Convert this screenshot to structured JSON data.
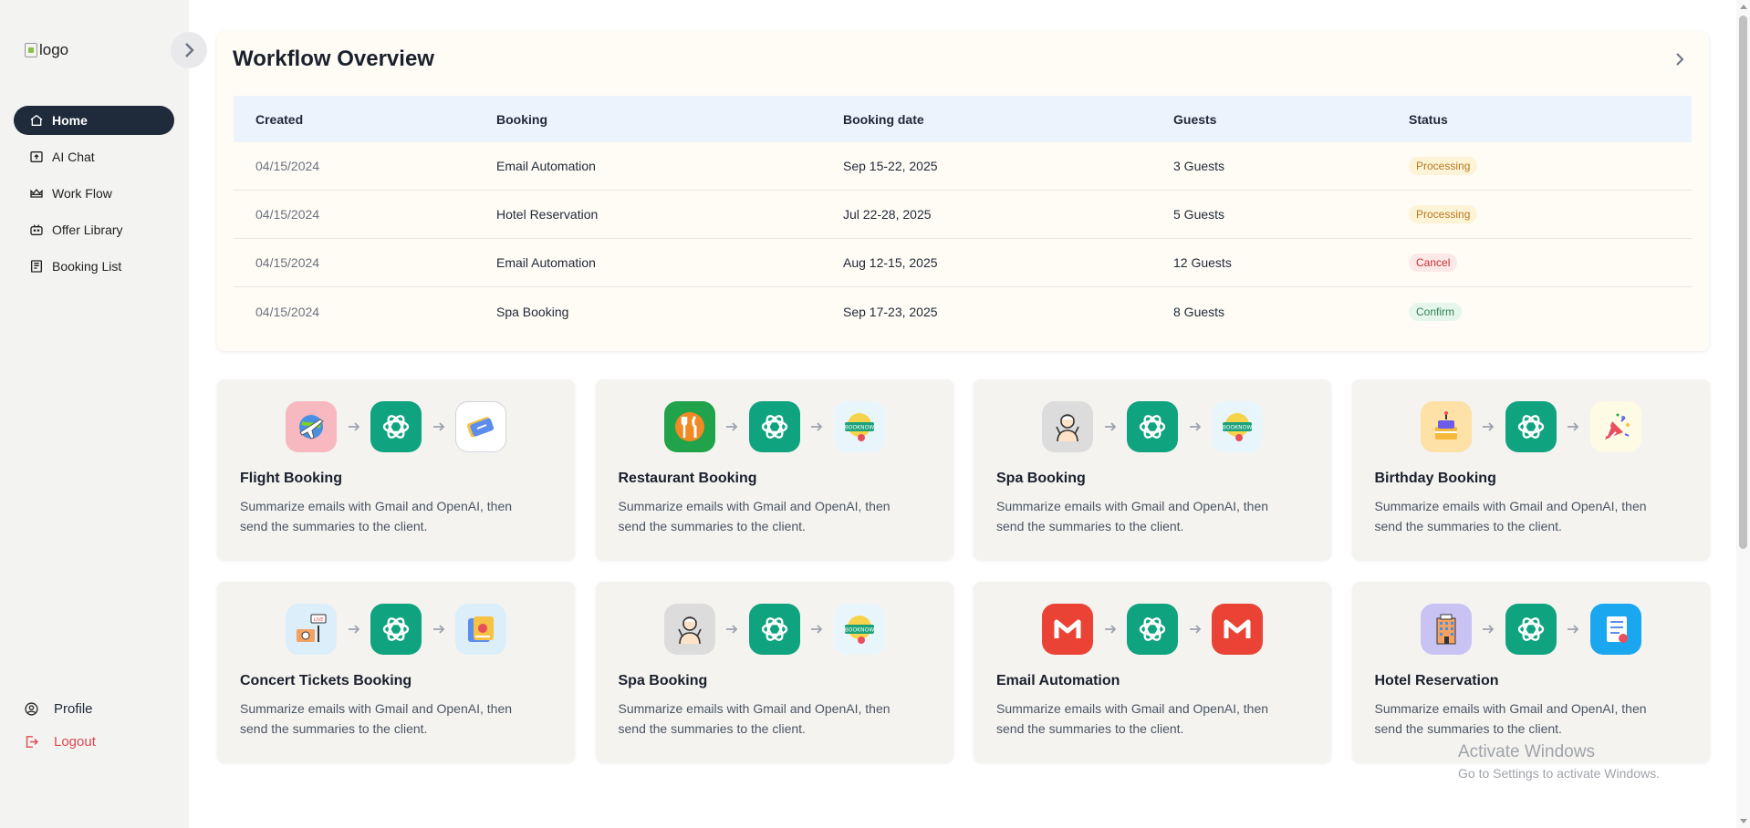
{
  "sidebar": {
    "logo_alt": "logo",
    "collapse_icon": "chevron-right-icon",
    "items": [
      {
        "label": "Home",
        "icon": "home-icon",
        "active": true
      },
      {
        "label": "AI Chat",
        "icon": "chat-upload-icon",
        "active": false
      },
      {
        "label": "Work Flow",
        "icon": "crown-icon",
        "active": false
      },
      {
        "label": "Offer Library",
        "icon": "robot-icon",
        "active": false
      },
      {
        "label": "Booking List",
        "icon": "book-icon",
        "active": false
      }
    ],
    "profile_label": "Profile",
    "logout_label": "Logout"
  },
  "overview": {
    "title": "Workflow Overview",
    "columns": [
      "Created",
      "Booking",
      "Booking date",
      "Guests",
      "Status"
    ],
    "rows": [
      {
        "created": "04/15/2024",
        "booking": "Email Automation",
        "date": "Sep 15-22, 2025",
        "guests": "3 Guests",
        "status": "Processing"
      },
      {
        "created": "04/15/2024",
        "booking": "Hotel Reservation",
        "date": "Jul 22-28, 2025",
        "guests": "5 Guests",
        "status": "Processing"
      },
      {
        "created": "04/15/2024",
        "booking": "Email Automation",
        "date": "Aug 12-15, 2025",
        "guests": "12 Guests",
        "status": "Cancel"
      },
      {
        "created": "04/15/2024",
        "booking": "Spa Booking",
        "date": "Sep 17-23, 2025",
        "guests": "8 Guests",
        "status": "Confirm"
      }
    ]
  },
  "cards": [
    {
      "title": "Flight Booking",
      "desc": "Summarize emails with Gmail and OpenAI, then send the summaries to the client.",
      "icons": [
        "airplane-globe-icon",
        "openai-icon",
        "ticket-icon"
      ]
    },
    {
      "title": "Restaurant Booking",
      "desc": "Summarize emails with Gmail and OpenAI, then send the summaries to the client.",
      "icons": [
        "fork-knife-icon",
        "openai-icon",
        "book-now-icon"
      ]
    },
    {
      "title": "Spa Booking",
      "desc": "Summarize emails with Gmail and OpenAI, then send the summaries to the client.",
      "icons": [
        "spa-person-icon",
        "openai-icon",
        "book-now-icon"
      ]
    },
    {
      "title": "Birthday Booking",
      "desc": "Summarize emails with Gmail and OpenAI, then send the summaries to the client.",
      "icons": [
        "birthday-cake-icon",
        "openai-icon",
        "party-popper-icon"
      ]
    },
    {
      "title": "Concert Tickets Booking",
      "desc": "Summarize emails with Gmail and OpenAI, then send the summaries to the client.",
      "icons": [
        "concert-stage-icon",
        "openai-icon",
        "concert-ticket-icon"
      ]
    },
    {
      "title": "Spa Booking",
      "desc": "Summarize emails with Gmail and OpenAI, then send the summaries to the client.",
      "icons": [
        "spa-person-icon",
        "openai-icon",
        "book-now-icon"
      ]
    },
    {
      "title": "Email Automation",
      "desc": "Summarize emails with Gmail and OpenAI, then send the summaries to the client.",
      "icons": [
        "gmail-icon",
        "openai-icon",
        "gmail-icon"
      ]
    },
    {
      "title": "Hotel Reservation",
      "desc": "Summarize emails with Gmail and OpenAI, then send the summaries to the client.",
      "icons": [
        "hotel-building-icon",
        "openai-icon",
        "checklist-icon"
      ]
    }
  ],
  "watermark": {
    "line1": "Activate Windows",
    "line2": "Go to Settings to activate Windows."
  },
  "colors": {
    "sidebar_active": "#1f2a3a",
    "logout": "#e0484f",
    "openai_green": "#10a37f",
    "processing": "#b7791f",
    "cancel": "#c53030",
    "confirm": "#2f855a"
  }
}
